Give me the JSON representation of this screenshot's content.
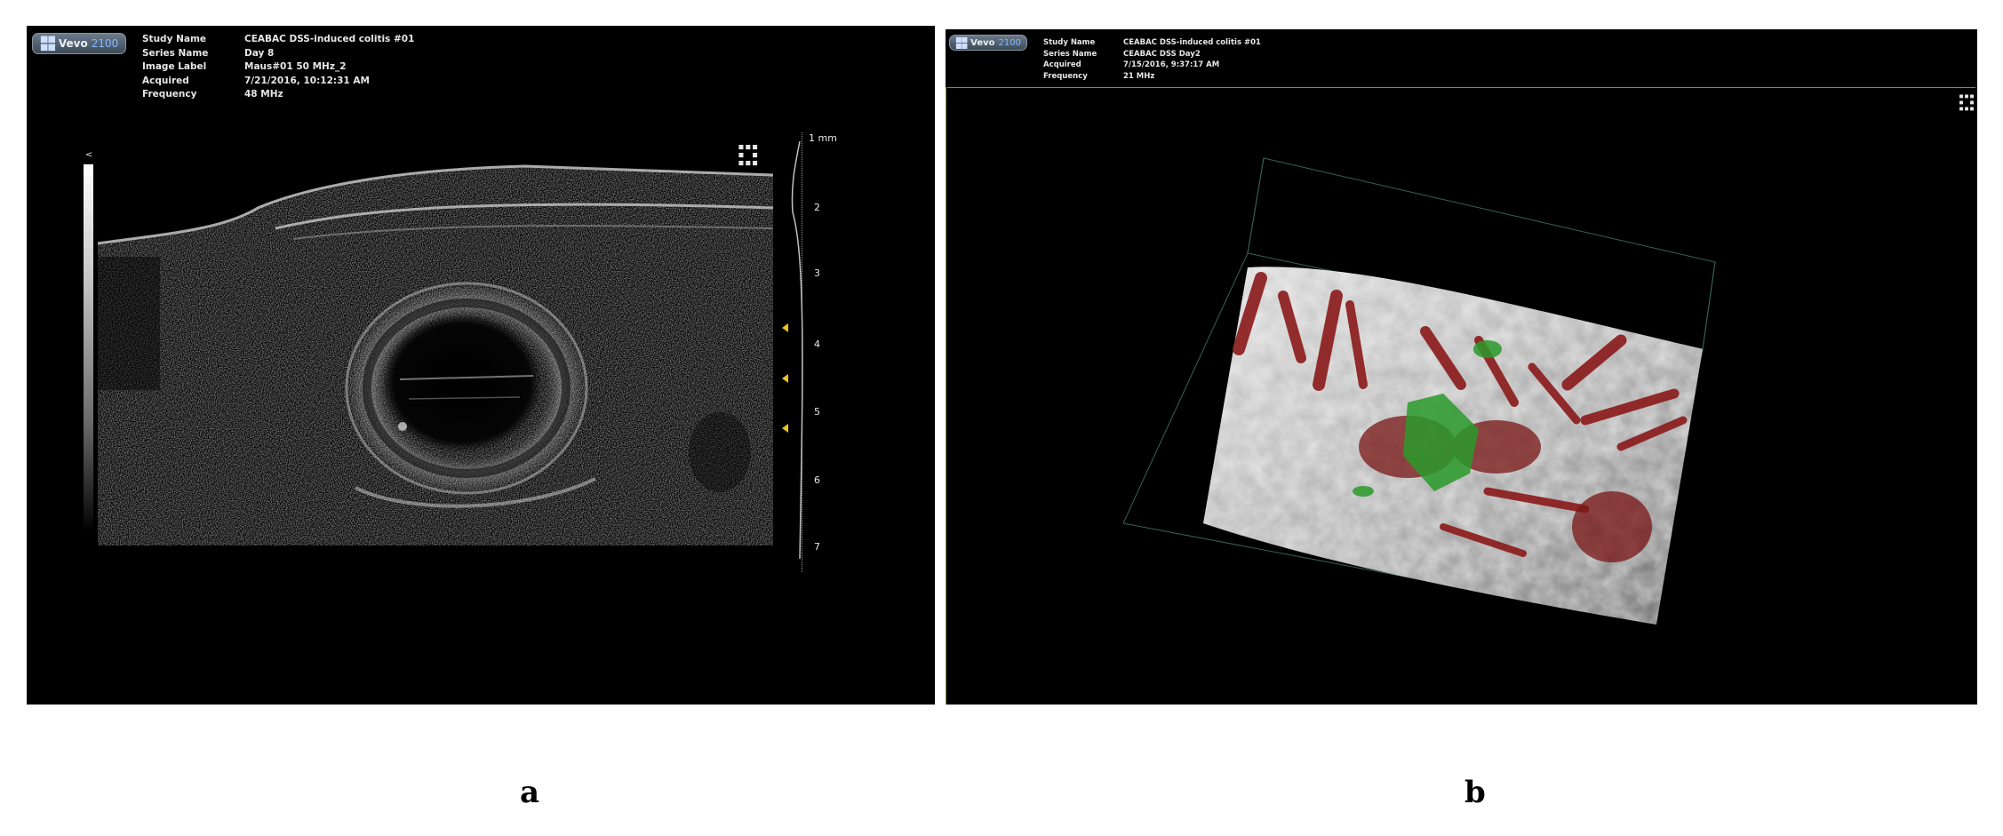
{
  "panel_a": {
    "logo": {
      "brand": "Vevo",
      "model": "2100"
    },
    "metadata": [
      {
        "label": "Study Name",
        "value": "CEABAC DSS-induced colitis #01"
      },
      {
        "label": "Series Name",
        "value": "Day 8"
      },
      {
        "label": "Image Label",
        "value": "Maus#01 50 MHz_2"
      },
      {
        "label": "Acquired",
        "value": "7/21/2016, 10:12:31 AM"
      },
      {
        "label": "Frequency",
        "value": "48 MHz"
      }
    ],
    "depth_scale": {
      "unit_label": "1 mm",
      "ticks": [
        "2",
        "3",
        "4",
        "5",
        "6",
        "7"
      ]
    },
    "gain_label": "<",
    "caption": "a"
  },
  "panel_b": {
    "logo": {
      "brand": "Vevo",
      "model": "2100"
    },
    "metadata": [
      {
        "label": "Study Name",
        "value": "CEABAC DSS-induced colitis #01"
      },
      {
        "label": "Series Name",
        "value": "CEABAC DSS Day2"
      },
      {
        "label": "Acquired",
        "value": "7/15/2016, 9:37:17 AM"
      },
      {
        "label": "Frequency",
        "value": "21 MHz"
      }
    ],
    "caption": "b"
  },
  "colors": {
    "background": "#000000",
    "depth_marker": "#f0c020",
    "vessels": "#8b1a1a",
    "perfusion": "#2a9a2a"
  }
}
